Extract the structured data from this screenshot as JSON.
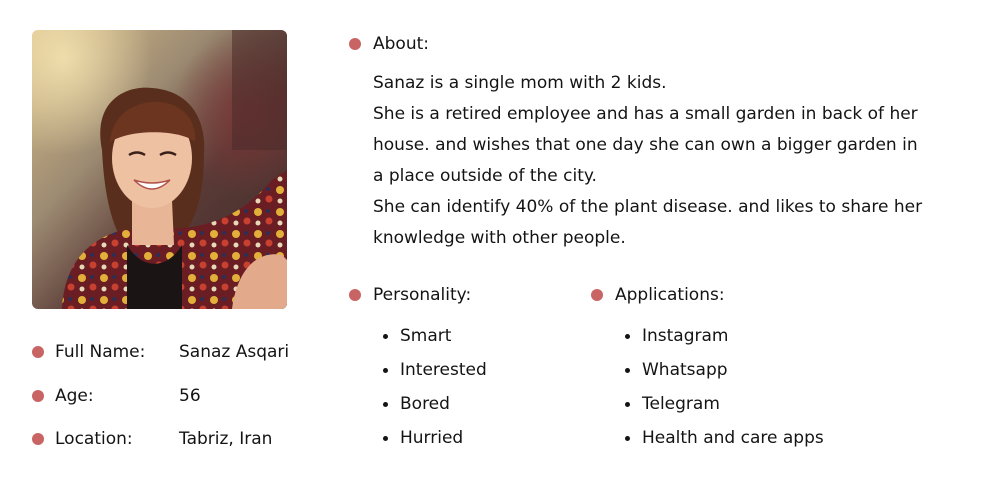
{
  "about": {
    "title": "About:",
    "lines": [
      "Sanaz is a single mom with 2 kids.",
      "She is a retired employee and has a small garden in back of her",
      "house. and wishes that one day she can own a bigger garden in",
      "a place outside of the city.",
      "She can identify 40% of the plant disease. and likes to share her",
      "knowledge with other people."
    ]
  },
  "profile": {
    "full_name_label": "Full Name:",
    "full_name": "Sanaz Asqari",
    "age_label": "Age:",
    "age": "56",
    "location_label": "Location:",
    "location": "Tabriz, Iran"
  },
  "personality": {
    "title": "Personality:",
    "items": [
      "Smart",
      "Interested",
      "Bored",
      "Hurried"
    ]
  },
  "applications": {
    "title": "Applications:",
    "items": [
      "Instagram",
      "Whatsapp",
      "Telegram",
      "Health and care apps"
    ]
  },
  "colors": {
    "accent_dot": "#c96464",
    "text": "#141414"
  }
}
